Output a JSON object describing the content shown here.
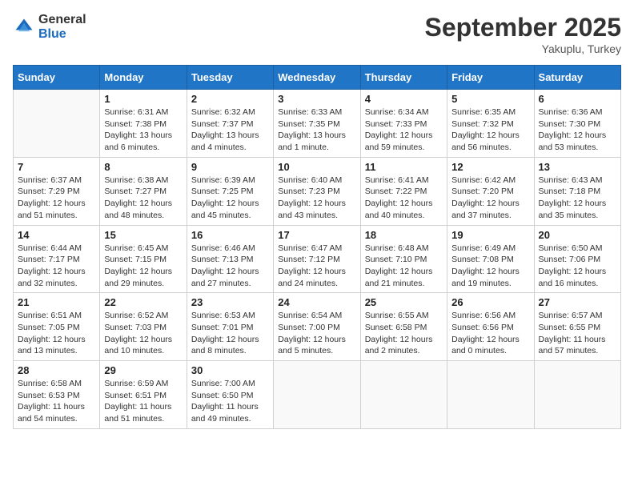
{
  "header": {
    "logo_general": "General",
    "logo_blue": "Blue",
    "month": "September 2025",
    "location": "Yakuplu, Turkey"
  },
  "days_of_week": [
    "Sunday",
    "Monday",
    "Tuesday",
    "Wednesday",
    "Thursday",
    "Friday",
    "Saturday"
  ],
  "weeks": [
    [
      {
        "day": "",
        "info": ""
      },
      {
        "day": "1",
        "info": "Sunrise: 6:31 AM\nSunset: 7:38 PM\nDaylight: 13 hours\nand 6 minutes."
      },
      {
        "day": "2",
        "info": "Sunrise: 6:32 AM\nSunset: 7:37 PM\nDaylight: 13 hours\nand 4 minutes."
      },
      {
        "day": "3",
        "info": "Sunrise: 6:33 AM\nSunset: 7:35 PM\nDaylight: 13 hours\nand 1 minute."
      },
      {
        "day": "4",
        "info": "Sunrise: 6:34 AM\nSunset: 7:33 PM\nDaylight: 12 hours\nand 59 minutes."
      },
      {
        "day": "5",
        "info": "Sunrise: 6:35 AM\nSunset: 7:32 PM\nDaylight: 12 hours\nand 56 minutes."
      },
      {
        "day": "6",
        "info": "Sunrise: 6:36 AM\nSunset: 7:30 PM\nDaylight: 12 hours\nand 53 minutes."
      }
    ],
    [
      {
        "day": "7",
        "info": "Sunrise: 6:37 AM\nSunset: 7:29 PM\nDaylight: 12 hours\nand 51 minutes."
      },
      {
        "day": "8",
        "info": "Sunrise: 6:38 AM\nSunset: 7:27 PM\nDaylight: 12 hours\nand 48 minutes."
      },
      {
        "day": "9",
        "info": "Sunrise: 6:39 AM\nSunset: 7:25 PM\nDaylight: 12 hours\nand 45 minutes."
      },
      {
        "day": "10",
        "info": "Sunrise: 6:40 AM\nSunset: 7:23 PM\nDaylight: 12 hours\nand 43 minutes."
      },
      {
        "day": "11",
        "info": "Sunrise: 6:41 AM\nSunset: 7:22 PM\nDaylight: 12 hours\nand 40 minutes."
      },
      {
        "day": "12",
        "info": "Sunrise: 6:42 AM\nSunset: 7:20 PM\nDaylight: 12 hours\nand 37 minutes."
      },
      {
        "day": "13",
        "info": "Sunrise: 6:43 AM\nSunset: 7:18 PM\nDaylight: 12 hours\nand 35 minutes."
      }
    ],
    [
      {
        "day": "14",
        "info": "Sunrise: 6:44 AM\nSunset: 7:17 PM\nDaylight: 12 hours\nand 32 minutes."
      },
      {
        "day": "15",
        "info": "Sunrise: 6:45 AM\nSunset: 7:15 PM\nDaylight: 12 hours\nand 29 minutes."
      },
      {
        "day": "16",
        "info": "Sunrise: 6:46 AM\nSunset: 7:13 PM\nDaylight: 12 hours\nand 27 minutes."
      },
      {
        "day": "17",
        "info": "Sunrise: 6:47 AM\nSunset: 7:12 PM\nDaylight: 12 hours\nand 24 minutes."
      },
      {
        "day": "18",
        "info": "Sunrise: 6:48 AM\nSunset: 7:10 PM\nDaylight: 12 hours\nand 21 minutes."
      },
      {
        "day": "19",
        "info": "Sunrise: 6:49 AM\nSunset: 7:08 PM\nDaylight: 12 hours\nand 19 minutes."
      },
      {
        "day": "20",
        "info": "Sunrise: 6:50 AM\nSunset: 7:06 PM\nDaylight: 12 hours\nand 16 minutes."
      }
    ],
    [
      {
        "day": "21",
        "info": "Sunrise: 6:51 AM\nSunset: 7:05 PM\nDaylight: 12 hours\nand 13 minutes."
      },
      {
        "day": "22",
        "info": "Sunrise: 6:52 AM\nSunset: 7:03 PM\nDaylight: 12 hours\nand 10 minutes."
      },
      {
        "day": "23",
        "info": "Sunrise: 6:53 AM\nSunset: 7:01 PM\nDaylight: 12 hours\nand 8 minutes."
      },
      {
        "day": "24",
        "info": "Sunrise: 6:54 AM\nSunset: 7:00 PM\nDaylight: 12 hours\nand 5 minutes."
      },
      {
        "day": "25",
        "info": "Sunrise: 6:55 AM\nSunset: 6:58 PM\nDaylight: 12 hours\nand 2 minutes."
      },
      {
        "day": "26",
        "info": "Sunrise: 6:56 AM\nSunset: 6:56 PM\nDaylight: 12 hours\nand 0 minutes."
      },
      {
        "day": "27",
        "info": "Sunrise: 6:57 AM\nSunset: 6:55 PM\nDaylight: 11 hours\nand 57 minutes."
      }
    ],
    [
      {
        "day": "28",
        "info": "Sunrise: 6:58 AM\nSunset: 6:53 PM\nDaylight: 11 hours\nand 54 minutes."
      },
      {
        "day": "29",
        "info": "Sunrise: 6:59 AM\nSunset: 6:51 PM\nDaylight: 11 hours\nand 51 minutes."
      },
      {
        "day": "30",
        "info": "Sunrise: 7:00 AM\nSunset: 6:50 PM\nDaylight: 11 hours\nand 49 minutes."
      },
      {
        "day": "",
        "info": ""
      },
      {
        "day": "",
        "info": ""
      },
      {
        "day": "",
        "info": ""
      },
      {
        "day": "",
        "info": ""
      }
    ]
  ]
}
